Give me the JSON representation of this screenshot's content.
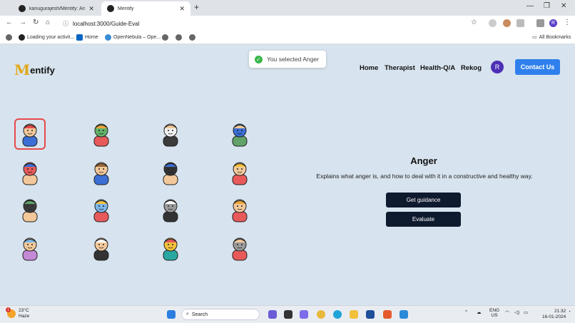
{
  "browser": {
    "tabs": [
      {
        "title": "kanugurajesh/Mentify: An all in"
      },
      {
        "title": "Mentify"
      }
    ],
    "address": "localhost:3000/Guide-Eval",
    "profile_initial": "R",
    "bookmarks": [
      "Loading your activit...",
      "Home",
      "OpenNebula – Ope..."
    ],
    "all_bookmarks": "All Bookmarks"
  },
  "header": {
    "logo_initial": "M",
    "logo_text": "entify",
    "nav": [
      "Home",
      "Therapist",
      "Health-Q/A",
      "Rekog"
    ],
    "avatar_initial": "R",
    "contact_label": "Contact Us"
  },
  "toast": {
    "message": "You selected Anger"
  },
  "topics": [
    {
      "icon": "angry-person-icon",
      "selected": true
    },
    {
      "icon": "social-anxiety-icon"
    },
    {
      "icon": "split-personality-icon"
    },
    {
      "icon": "depressed-person-icon"
    },
    {
      "icon": "eating-disorder-icon"
    },
    {
      "icon": "loneliness-icon"
    },
    {
      "icon": "stress-icon"
    },
    {
      "icon": "trapped-person-icon"
    },
    {
      "icon": "hearing-voices-icon"
    },
    {
      "icon": "panic-warning-icon"
    },
    {
      "icon": "memory-loss-icon"
    },
    {
      "icon": "headache-icon"
    },
    {
      "icon": "brain-mask-icon"
    },
    {
      "icon": "overthinking-icon"
    },
    {
      "icon": "mirror-self-image-icon"
    },
    {
      "icon": "addiction-fist-icon"
    }
  ],
  "detail": {
    "title": "Anger",
    "description": "Explains what anger is, and how to deal with it in a constructive and healthy way.",
    "guidance_label": "Get guidance",
    "evaluate_label": "Evaluate"
  },
  "taskbar": {
    "temperature": "23°C",
    "condition": "Haze",
    "search_placeholder": "Search",
    "lang_top": "ENG",
    "lang_bottom": "US",
    "time": "21:32",
    "date": "16-01-2024",
    "weather_badge": "1"
  }
}
